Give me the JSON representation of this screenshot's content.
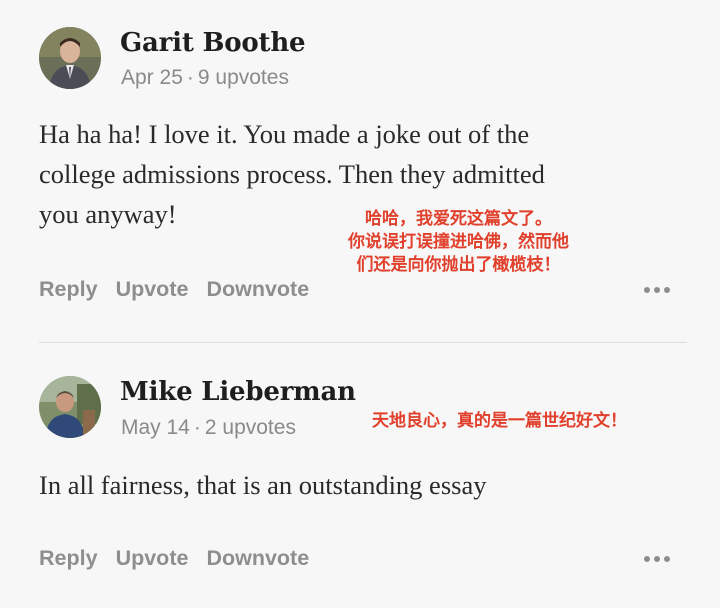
{
  "comments": [
    {
      "author": "Garit Boothe",
      "date": "Apr 25",
      "separator": "·",
      "upvotes": "9 upvotes",
      "body_lines": [
        "Ha ha ha! I love it. You made a joke out of the",
        "college admissions process. Then they admitted",
        "you anyway!"
      ]
    },
    {
      "author": "Mike Lieberman",
      "date": "May 14",
      "separator": "·",
      "upvotes": "2 upvotes",
      "body_lines": [
        "In all fairness, that is an outstanding essay"
      ]
    }
  ],
  "actions": {
    "reply": "Reply",
    "upvote": "Upvote",
    "downvote": "Downvote"
  },
  "annotations": {
    "first": [
      "哈哈，我爱死这篇文了。",
      "你说误打误撞进哈佛，然而他",
      "们还是向你抛出了橄榄枝！"
    ],
    "second": "天地良心，真的是一篇世纪好文！"
  },
  "colors": {
    "background": "#f7f7f7",
    "annotation": "#e0402c",
    "muted": "#8a8a8a"
  }
}
